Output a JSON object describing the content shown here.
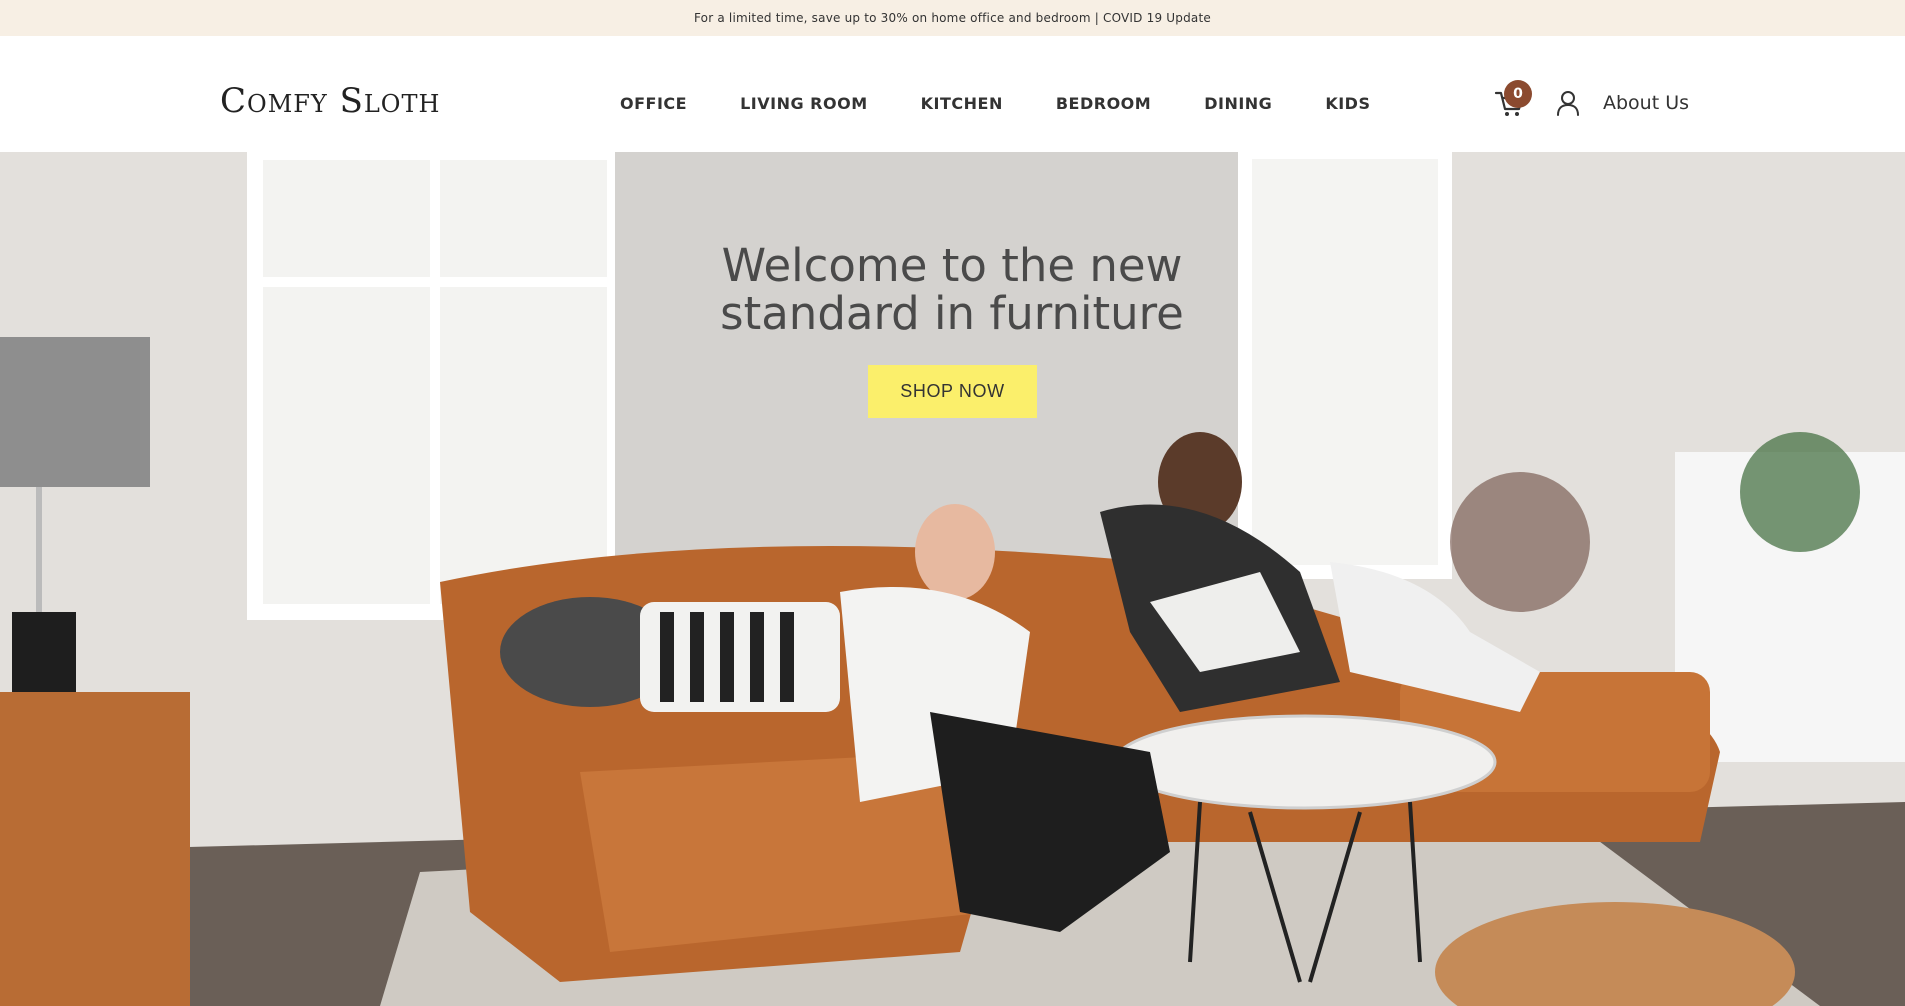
{
  "announcement": {
    "text": "For a limited time, save up to 30% on home office and bedroom | COVID 19 Update"
  },
  "header": {
    "logo": "Comfy Sloth",
    "nav": [
      {
        "label": "OFFICE"
      },
      {
        "label": "LIVING ROOM"
      },
      {
        "label": "KITCHEN"
      },
      {
        "label": "BEDROOM"
      },
      {
        "label": "DINING"
      },
      {
        "label": "KIDS"
      }
    ],
    "cart_count": "0",
    "about_label": "About Us",
    "icons": {
      "cart": "cart-icon",
      "user": "user-icon"
    }
  },
  "hero": {
    "title_line1": "Welcome to the new",
    "title_line2": "standard in furniture",
    "cta_label": "SHOP NOW"
  },
  "colors": {
    "announcement_bg": "#f7efe4",
    "badge": "#8b4a2f",
    "cta": "#fbef6b"
  }
}
